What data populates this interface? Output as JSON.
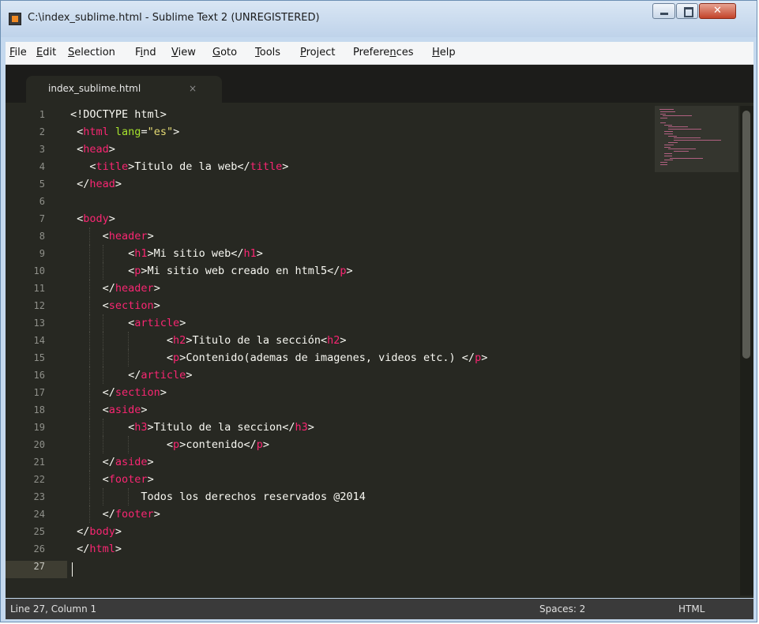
{
  "window": {
    "title": "C:\\index_sublime.html - Sublime Text 2 (UNREGISTERED)"
  },
  "menu": {
    "items": [
      {
        "pre": "",
        "u": "F",
        "post": "ile"
      },
      {
        "pre": "",
        "u": "E",
        "post": "dit"
      },
      {
        "pre": "",
        "u": "S",
        "post": "election"
      },
      {
        "pre": "F",
        "u": "i",
        "post": "nd"
      },
      {
        "pre": "",
        "u": "V",
        "post": "iew"
      },
      {
        "pre": "",
        "u": "G",
        "post": "oto"
      },
      {
        "pre": "",
        "u": "T",
        "post": "ools"
      },
      {
        "pre": "",
        "u": "P",
        "post": "roject"
      },
      {
        "pre": "Prefere",
        "u": "n",
        "post": "ces"
      },
      {
        "pre": "",
        "u": "H",
        "post": "elp"
      }
    ]
  },
  "tab": {
    "label": "index_sublime.html",
    "close_glyph": "×"
  },
  "code": {
    "lines": [
      "<!DOCTYPE html>",
      " <html lang=\"es\">",
      " <head>",
      "   <title>Titulo de la web</title>",
      " </head>",
      "",
      " <body>",
      "     <header>",
      "         <h1>Mi sitio web</h1>",
      "         <p>Mi sitio web creado en html5</p>",
      "     </header>",
      "     <section>",
      "         <article>",
      "               <h2>Titulo de la sección<h2>",
      "               <p>Contenido(ademas de imagenes, videos etc.) </p>",
      "         </article>",
      "     </section>",
      "     <aside>",
      "         <h3>Titulo de la seccion</h3>",
      "               <p>contenido</p>",
      "     </aside>",
      "     <footer>",
      "           Todos los derechos reservados @2014",
      "     </footer>",
      " </body>",
      " </html>",
      ""
    ]
  },
  "status": {
    "position": "Line 27, Column 1",
    "indent": "Spaces: 2",
    "syntax": "HTML"
  },
  "colors": {
    "background": "#272822",
    "tag": "#f92672",
    "attr": "#a6e22e",
    "string": "#e6db74",
    "text": "#f8f8f2",
    "gutter": "#8f908a"
  }
}
